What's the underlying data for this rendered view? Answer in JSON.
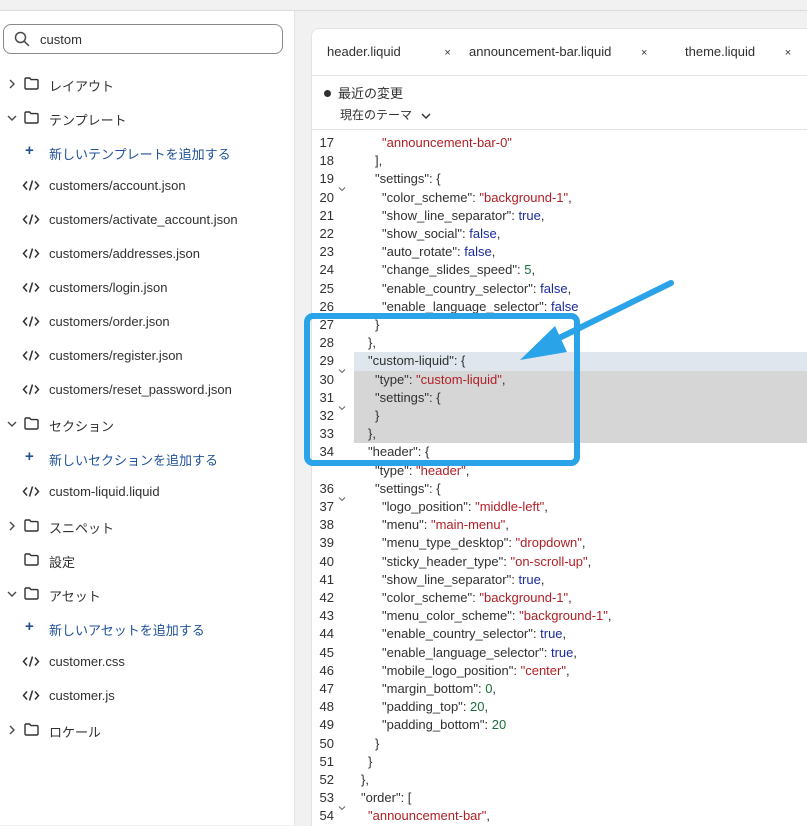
{
  "search": {
    "value": "custom",
    "icon": "search-icon"
  },
  "tree": [
    {
      "type": "folder",
      "label": "レイアウト",
      "expanded": false
    },
    {
      "type": "folder",
      "label": "テンプレート",
      "expanded": true
    },
    {
      "type": "add",
      "label": "新しいテンプレートを追加する"
    },
    {
      "type": "file",
      "label": "customers/account.json"
    },
    {
      "type": "file",
      "label": "customers/activate_account.json"
    },
    {
      "type": "file",
      "label": "customers/addresses.json"
    },
    {
      "type": "file",
      "label": "customers/login.json"
    },
    {
      "type": "file",
      "label": "customers/order.json"
    },
    {
      "type": "file",
      "label": "customers/register.json"
    },
    {
      "type": "file",
      "label": "customers/reset_password.json"
    },
    {
      "type": "folder",
      "label": "セクション",
      "expanded": true
    },
    {
      "type": "add",
      "label": "新しいセクションを追加する"
    },
    {
      "type": "file",
      "label": "custom-liquid.liquid"
    },
    {
      "type": "folder",
      "label": "スニペット",
      "expanded": false
    },
    {
      "type": "folder-nochev",
      "label": "設定"
    },
    {
      "type": "folder",
      "label": "アセット",
      "expanded": true
    },
    {
      "type": "add",
      "label": "新しいアセットを追加する"
    },
    {
      "type": "file",
      "label": "customer.css"
    },
    {
      "type": "file",
      "label": "customer.js"
    },
    {
      "type": "folder",
      "label": "ロケール",
      "expanded": false
    }
  ],
  "tabs": [
    {
      "label": "header.liquid",
      "close": "×"
    },
    {
      "label": "announcement-bar.liquid",
      "close": "×"
    },
    {
      "label": "theme.liquid",
      "close": "×"
    }
  ],
  "editor": {
    "changes_label": "最近の変更",
    "theme_select": "現在のテーマ"
  },
  "code_lines": [
    {
      "n": "17",
      "fold": false,
      "indent": 5,
      "tokens": [
        [
          "s",
          "\"announcement-bar-0\""
        ]
      ]
    },
    {
      "n": "18",
      "fold": false,
      "indent": 4,
      "tokens": [
        [
          "p",
          "],"
        ]
      ]
    },
    {
      "n": "19",
      "fold": true,
      "indent": 4,
      "tokens": [
        [
          "k",
          "\"settings\""
        ],
        [
          "p",
          ": {"
        ]
      ]
    },
    {
      "n": "20",
      "fold": false,
      "indent": 5,
      "tokens": [
        [
          "k",
          "\"color_scheme\""
        ],
        [
          "p",
          ": "
        ],
        [
          "s",
          "\"background-1\""
        ],
        [
          "p",
          ","
        ]
      ]
    },
    {
      "n": "21",
      "fold": false,
      "indent": 5,
      "tokens": [
        [
          "k",
          "\"show_line_separator\""
        ],
        [
          "p",
          ": "
        ],
        [
          "b",
          "true"
        ],
        [
          "p",
          ","
        ]
      ]
    },
    {
      "n": "22",
      "fold": false,
      "indent": 5,
      "tokens": [
        [
          "k",
          "\"show_social\""
        ],
        [
          "p",
          ": "
        ],
        [
          "b",
          "false"
        ],
        [
          "p",
          ","
        ]
      ]
    },
    {
      "n": "23",
      "fold": false,
      "indent": 5,
      "tokens": [
        [
          "k",
          "\"auto_rotate\""
        ],
        [
          "p",
          ": "
        ],
        [
          "b",
          "false"
        ],
        [
          "p",
          ","
        ]
      ]
    },
    {
      "n": "24",
      "fold": false,
      "indent": 5,
      "tokens": [
        [
          "k",
          "\"change_slides_speed\""
        ],
        [
          "p",
          ": "
        ],
        [
          "n",
          "5"
        ],
        [
          "p",
          ","
        ]
      ]
    },
    {
      "n": "25",
      "fold": false,
      "indent": 5,
      "tokens": [
        [
          "k",
          "\"enable_country_selector\""
        ],
        [
          "p",
          ": "
        ],
        [
          "b",
          "false"
        ],
        [
          "p",
          ","
        ]
      ]
    },
    {
      "n": "26",
      "fold": false,
      "indent": 5,
      "tokens": [
        [
          "k",
          "\"enable_language_selector\""
        ],
        [
          "p",
          ": "
        ],
        [
          "b",
          "false"
        ]
      ]
    },
    {
      "n": "27",
      "fold": false,
      "indent": 4,
      "tokens": [
        [
          "p",
          "}"
        ]
      ]
    },
    {
      "n": "28",
      "fold": false,
      "indent": 3,
      "tokens": [
        [
          "p",
          "},"
        ]
      ]
    },
    {
      "n": "29",
      "fold": true,
      "indent": 3,
      "hl": "light",
      "tokens": [
        [
          "k",
          "\"custom-liquid\""
        ],
        [
          "p",
          ": {"
        ]
      ]
    },
    {
      "n": "30",
      "fold": false,
      "indent": 4,
      "hl": "dark",
      "tokens": [
        [
          "k",
          "\"type\""
        ],
        [
          "p",
          ": "
        ],
        [
          "s",
          "\"custom-liquid\""
        ],
        [
          "p",
          ","
        ]
      ]
    },
    {
      "n": "31",
      "fold": true,
      "indent": 4,
      "hl": "dark",
      "tokens": [
        [
          "k",
          "\"settings\""
        ],
        [
          "p",
          ": {"
        ]
      ]
    },
    {
      "n": "32",
      "fold": false,
      "indent": 4,
      "hl": "dark",
      "tokens": [
        [
          "p",
          "}"
        ]
      ]
    },
    {
      "n": "33",
      "fold": false,
      "indent": 3,
      "hl": "dark",
      "tokens": [
        [
          "p",
          "},"
        ]
      ]
    },
    {
      "n": "34",
      "fold": true,
      "indent": 3,
      "tokens": [
        [
          "k",
          "\"header\""
        ],
        [
          "p",
          ": {"
        ]
      ]
    },
    {
      "n": "",
      "fold": false,
      "indent": 4,
      "tokens": [
        [
          "k",
          "\"type\""
        ],
        [
          "p",
          ": "
        ],
        [
          "s",
          "\"header\""
        ],
        [
          "p",
          ","
        ]
      ]
    },
    {
      "n": "36",
      "fold": true,
      "indent": 4,
      "tokens": [
        [
          "k",
          "\"settings\""
        ],
        [
          "p",
          ": {"
        ]
      ]
    },
    {
      "n": "37",
      "fold": false,
      "indent": 5,
      "tokens": [
        [
          "k",
          "\"logo_position\""
        ],
        [
          "p",
          ": "
        ],
        [
          "s",
          "\"middle-left\""
        ],
        [
          "p",
          ","
        ]
      ]
    },
    {
      "n": "38",
      "fold": false,
      "indent": 5,
      "tokens": [
        [
          "k",
          "\"menu\""
        ],
        [
          "p",
          ": "
        ],
        [
          "s",
          "\"main-menu\""
        ],
        [
          "p",
          ","
        ]
      ]
    },
    {
      "n": "39",
      "fold": false,
      "indent": 5,
      "tokens": [
        [
          "k",
          "\"menu_type_desktop\""
        ],
        [
          "p",
          ": "
        ],
        [
          "s",
          "\"dropdown\""
        ],
        [
          "p",
          ","
        ]
      ]
    },
    {
      "n": "40",
      "fold": false,
      "indent": 5,
      "tokens": [
        [
          "k",
          "\"sticky_header_type\""
        ],
        [
          "p",
          ": "
        ],
        [
          "s",
          "\"on-scroll-up\""
        ],
        [
          "p",
          ","
        ]
      ]
    },
    {
      "n": "41",
      "fold": false,
      "indent": 5,
      "tokens": [
        [
          "k",
          "\"show_line_separator\""
        ],
        [
          "p",
          ": "
        ],
        [
          "b",
          "true"
        ],
        [
          "p",
          ","
        ]
      ]
    },
    {
      "n": "42",
      "fold": false,
      "indent": 5,
      "tokens": [
        [
          "k",
          "\"color_scheme\""
        ],
        [
          "p",
          ": "
        ],
        [
          "s",
          "\"background-1\""
        ],
        [
          "p",
          ","
        ]
      ]
    },
    {
      "n": "43",
      "fold": false,
      "indent": 5,
      "tokens": [
        [
          "k",
          "\"menu_color_scheme\""
        ],
        [
          "p",
          ": "
        ],
        [
          "s",
          "\"background-1\""
        ],
        [
          "p",
          ","
        ]
      ]
    },
    {
      "n": "44",
      "fold": false,
      "indent": 5,
      "tokens": [
        [
          "k",
          "\"enable_country_selector\""
        ],
        [
          "p",
          ": "
        ],
        [
          "b",
          "true"
        ],
        [
          "p",
          ","
        ]
      ]
    },
    {
      "n": "45",
      "fold": false,
      "indent": 5,
      "tokens": [
        [
          "k",
          "\"enable_language_selector\""
        ],
        [
          "p",
          ": "
        ],
        [
          "b",
          "true"
        ],
        [
          "p",
          ","
        ]
      ]
    },
    {
      "n": "46",
      "fold": false,
      "indent": 5,
      "tokens": [
        [
          "k",
          "\"mobile_logo_position\""
        ],
        [
          "p",
          ": "
        ],
        [
          "s",
          "\"center\""
        ],
        [
          "p",
          ","
        ]
      ]
    },
    {
      "n": "47",
      "fold": false,
      "indent": 5,
      "tokens": [
        [
          "k",
          "\"margin_bottom\""
        ],
        [
          "p",
          ": "
        ],
        [
          "n",
          "0"
        ],
        [
          "p",
          ","
        ]
      ]
    },
    {
      "n": "48",
      "fold": false,
      "indent": 5,
      "tokens": [
        [
          "k",
          "\"padding_top\""
        ],
        [
          "p",
          ": "
        ],
        [
          "n",
          "20"
        ],
        [
          "p",
          ","
        ]
      ]
    },
    {
      "n": "49",
      "fold": false,
      "indent": 5,
      "tokens": [
        [
          "k",
          "\"padding_bottom\""
        ],
        [
          "p",
          ": "
        ],
        [
          "n",
          "20"
        ]
      ]
    },
    {
      "n": "50",
      "fold": false,
      "indent": 4,
      "tokens": [
        [
          "p",
          "}"
        ]
      ]
    },
    {
      "n": "51",
      "fold": false,
      "indent": 3,
      "tokens": [
        [
          "p",
          "}"
        ]
      ]
    },
    {
      "n": "52",
      "fold": false,
      "indent": 2,
      "tokens": [
        [
          "p",
          "},"
        ]
      ]
    },
    {
      "n": "53",
      "fold": true,
      "indent": 2,
      "tokens": [
        [
          "k",
          "\"order\""
        ],
        [
          "p",
          ": ["
        ]
      ]
    },
    {
      "n": "54",
      "fold": false,
      "indent": 3,
      "tokens": [
        [
          "s",
          "\"announcement-bar\""
        ],
        [
          "p",
          ","
        ]
      ]
    }
  ],
  "annotation": {
    "color": "#2aa3e8",
    "shapes": [
      "highlight-box",
      "arrow"
    ]
  },
  "colors": {
    "string": "#b11f26",
    "number": "#1a6e3a",
    "boolean": "#1a2aa0",
    "link": "#1f5199"
  }
}
